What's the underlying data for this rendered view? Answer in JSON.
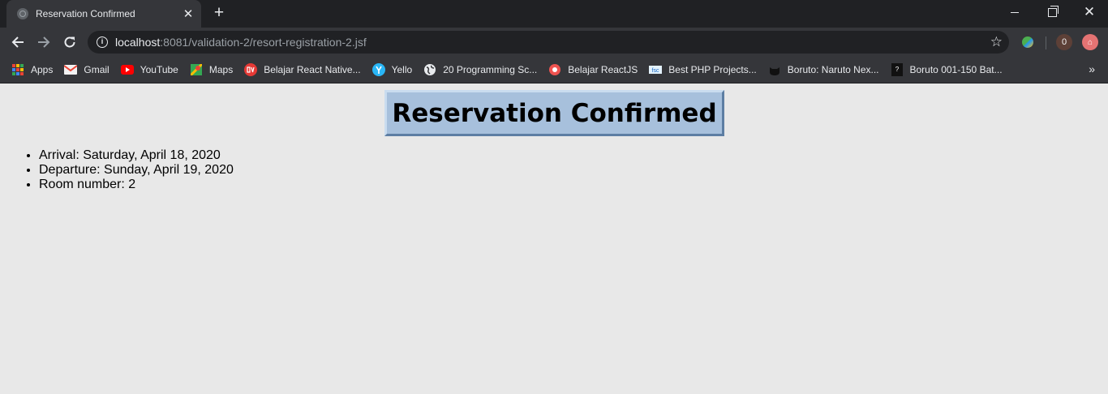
{
  "browser": {
    "tab": {
      "title": "Reservation Confirmed"
    },
    "address": {
      "host": "localhost",
      "rest": ":8081/validation-2/resort-registration-2.jsf"
    },
    "extensions": {
      "counter_badge": "0"
    },
    "bookmarks": [
      {
        "label": "Apps",
        "icon": "apps-grid-icon"
      },
      {
        "label": "Gmail",
        "icon": "gmail-icon"
      },
      {
        "label": "YouTube",
        "icon": "youtube-icon"
      },
      {
        "label": "Maps",
        "icon": "maps-icon"
      },
      {
        "label": "Belajar React Native...",
        "icon": "dw-icon"
      },
      {
        "label": "Yello",
        "icon": "yello-icon"
      },
      {
        "label": "20 Programming Sc...",
        "icon": "globe-icon"
      },
      {
        "label": "Belajar ReactJS",
        "icon": "reactjs-icon"
      },
      {
        "label": "Best PHP Projects...",
        "icon": "php-icon"
      },
      {
        "label": "Boruto: Naruto Nex...",
        "icon": "cat-icon"
      },
      {
        "label": "Boruto 001-150 Bat...",
        "icon": "boruto-icon"
      }
    ]
  },
  "page": {
    "heading": "Reservation Confirmed",
    "details": [
      "Arrival: Saturday, April 18, 2020",
      "Departure: Sunday, April 19, 2020",
      "Room number: 2"
    ]
  }
}
